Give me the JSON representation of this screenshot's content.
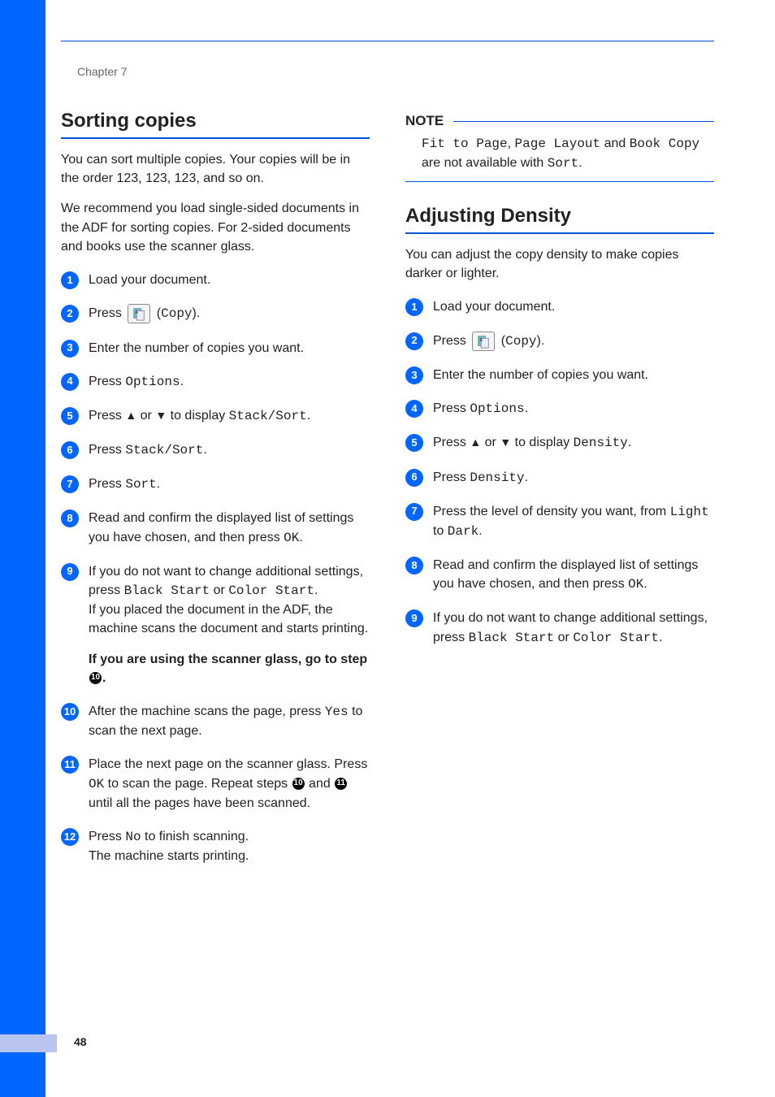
{
  "chapter_label": "Chapter 7",
  "page_number": "48",
  "left": {
    "title": "Sorting copies",
    "intro1": "You can sort multiple copies. Your copies will be in the order 123, 123, 123, and so on.",
    "intro2": "We recommend you load single-sided documents in the ADF for sorting copies. For 2-sided documents and books use the scanner glass.",
    "s1": "Load your document.",
    "s2_a": "Press ",
    "s2_b": " (",
    "s2_c": ").",
    "copy_label": "Copy",
    "s3": "Enter the number of copies you want.",
    "s4_a": "Press ",
    "s4_b": ".",
    "options": "Options",
    "s5_a": "Press ",
    "s5_b": " or ",
    "s5_c": " to display ",
    "s5_d": ".",
    "up": "a",
    "down": "b",
    "stack_sort": "Stack/Sort",
    "s6_a": "Press ",
    "s6_b": ".",
    "s7_a": "Press ",
    "s7_b": ".",
    "sort": "Sort",
    "s8_a": "Read and confirm the displayed list of settings you have chosen, and then press ",
    "s8_b": ".",
    "ok": "OK",
    "s9_a": "If you do not want to change additional settings, press ",
    "s9_b": " or ",
    "s9_c": ".",
    "black_start": "Black Start",
    "color_start": "Color Start",
    "s9_d": "If you placed the document in the ADF, the machine scans the document and starts printing.",
    "s9_e1": "If you are using the scanner glass, go to step ",
    "s9_e2": ".",
    "s10_a": "After the machine scans the page, press ",
    "s10_b": " to scan the next page.",
    "yes": "Yes",
    "s11_a": "Place the next page on the scanner glass. Press ",
    "s11_b": " to scan the page.",
    "s11_c": "Repeat steps ",
    "s11_d": " and ",
    "s11_e": " until all the pages have been scanned.",
    "s12_a": "Press ",
    "s12_b": " to finish scanning.",
    "no": "No",
    "s12_c": "The machine starts printing."
  },
  "right": {
    "note_label": "NOTE",
    "note_t1": "Fit to Page",
    "note_t2": "Page Layout",
    "note_t3": "Book Copy",
    "note_a": ", ",
    "note_b": " and ",
    "note_c": " are not available with ",
    "note_d": ".",
    "sort": "Sort",
    "title": "Adjusting Density",
    "intro": "You can adjust the copy density to make copies darker or lighter.",
    "s1": "Load your document.",
    "s2_a": "Press ",
    "s2_b": " (",
    "s2_c": ").",
    "copy_label": "Copy",
    "s3": "Enter the number of copies you want.",
    "s4_a": "Press ",
    "s4_b": ".",
    "options": "Options",
    "s5_a": "Press ",
    "s5_b": " or ",
    "s5_c": " to display ",
    "s5_d": ".",
    "density": "Density",
    "s6_a": "Press ",
    "s6_b": ".",
    "s7_a": "Press the level of density you want, from ",
    "s7_b": " to ",
    "s7_c": ".",
    "light": "Light",
    "dark": "Dark",
    "s8_a": "Read and confirm the displayed list of settings you have chosen, and then press ",
    "s8_b": ".",
    "ok": "OK",
    "s9_a": "If you do not want to change additional settings, press ",
    "s9_b": " or ",
    "s9_c": ".",
    "black_start": "Black Start",
    "color_start": "Color Start"
  }
}
